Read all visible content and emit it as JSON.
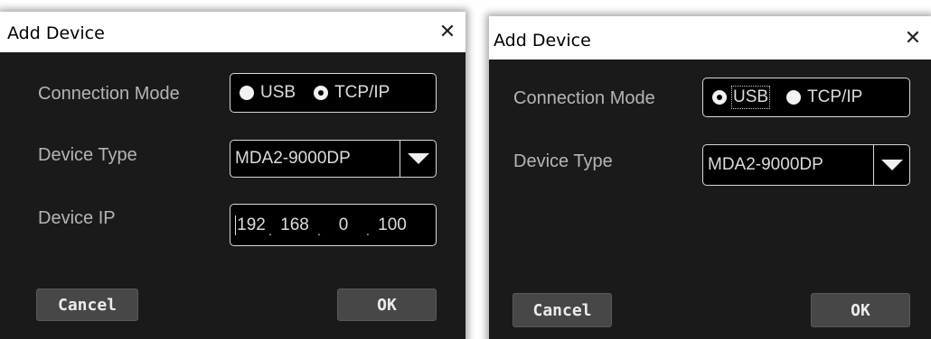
{
  "dialogs": [
    {
      "title": "Add Device",
      "close_glyph": "✕",
      "connection_mode": {
        "label": "Connection Mode",
        "options": [
          "USB",
          "TCP/IP"
        ],
        "selected": "TCP/IP"
      },
      "device_type": {
        "label": "Device Type",
        "value": "MDA2-9000DP"
      },
      "device_ip": {
        "label": "Device IP",
        "octets": [
          "192",
          "168",
          "0",
          "100"
        ]
      },
      "cancel_label": "Cancel",
      "ok_label": "OK"
    },
    {
      "title": "Add Device",
      "close_glyph": "✕",
      "connection_mode": {
        "label": "Connection Mode",
        "options": [
          "USB",
          "TCP/IP"
        ],
        "selected": "USB"
      },
      "device_type": {
        "label": "Device Type",
        "value": "MDA2-9000DP"
      },
      "cancel_label": "Cancel",
      "ok_label": "OK"
    }
  ],
  "colors": {
    "dialog_bg": "#1a1a1a",
    "titlebar_bg": "#ffffff",
    "label_text": "#b5b5b5",
    "button_bg": "#474747"
  },
  "icons": {
    "close": "close-icon",
    "dropdown": "chevron-down-icon"
  }
}
